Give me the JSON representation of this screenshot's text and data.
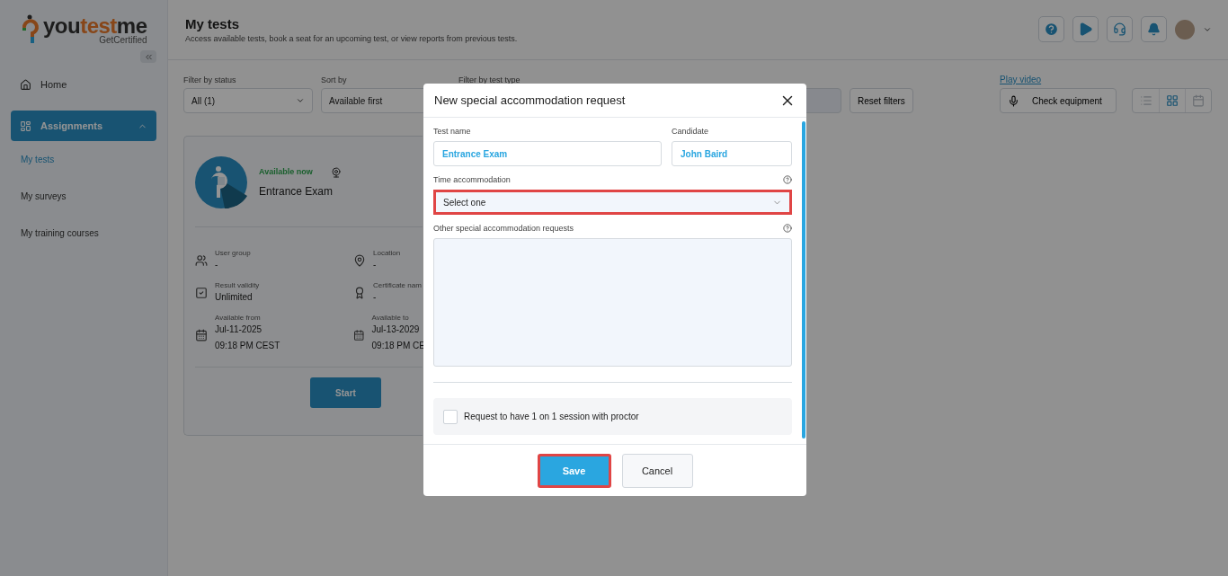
{
  "logo": {
    "parts": [
      "you",
      "test",
      "me"
    ],
    "tagline": "GetCertified"
  },
  "sidebar": {
    "items": [
      {
        "label": "Home",
        "kind": "link",
        "selected": false
      },
      {
        "label": "Assignments",
        "kind": "group",
        "selected": true,
        "expanded": true,
        "children": [
          {
            "label": "My tests",
            "selected": true
          },
          {
            "label": "My surveys",
            "selected": false
          },
          {
            "label": "My training courses",
            "selected": false
          }
        ]
      }
    ]
  },
  "header": {
    "title": "My tests",
    "subtitle": "Access available tests, book a seat for an upcoming test, or view reports from previous tests."
  },
  "filters": {
    "status": {
      "label": "Filter by status",
      "value": "All (1)"
    },
    "sort": {
      "label": "Sort by",
      "value": "Available first"
    },
    "test_type": {
      "label": "Filter by test type"
    },
    "reset": "Reset filters",
    "play_video": "Play video",
    "check_equipment": "Check equipment",
    "views": [
      {
        "kind": "list",
        "selected": false
      },
      {
        "kind": "grid",
        "selected": true
      },
      {
        "kind": "calendar",
        "selected": false
      }
    ]
  },
  "test_card": {
    "status": "Available now",
    "name": "Entrance Exam",
    "start": "Start",
    "details": [
      {
        "kind": "group",
        "label": "User group",
        "value": "-"
      },
      {
        "kind": "location",
        "label": "Location",
        "value": "-"
      },
      {
        "kind": "validity",
        "label": "Result validity",
        "value": "Unlimited"
      },
      {
        "kind": "certificate",
        "label": "Certificate nam",
        "value": "-"
      },
      {
        "kind": "date",
        "label": "Available from",
        "value": "Jul-11-2025",
        "time": "09:18 PM CEST"
      },
      {
        "kind": "date",
        "label": "Available to",
        "value": "Jul-13-2029",
        "time": "09:18 PM CE"
      }
    ]
  },
  "modal": {
    "title": "New special accommodation request",
    "test_name": {
      "label": "Test name",
      "value": "Entrance Exam"
    },
    "candidate": {
      "label": "Candidate",
      "value": "John Baird"
    },
    "time_accommodation": {
      "label": "Time accommodation",
      "value": "Select one",
      "highlighted": true
    },
    "other_requests": {
      "label": "Other special accommodation requests"
    },
    "one_on_one": {
      "label": "Request to have 1 on 1 session with proctor",
      "checked": false
    },
    "buttons": [
      {
        "label": "Save",
        "kind": "primary",
        "highlighted": true
      },
      {
        "label": "Cancel",
        "kind": "secondary",
        "highlighted": false
      }
    ]
  }
}
